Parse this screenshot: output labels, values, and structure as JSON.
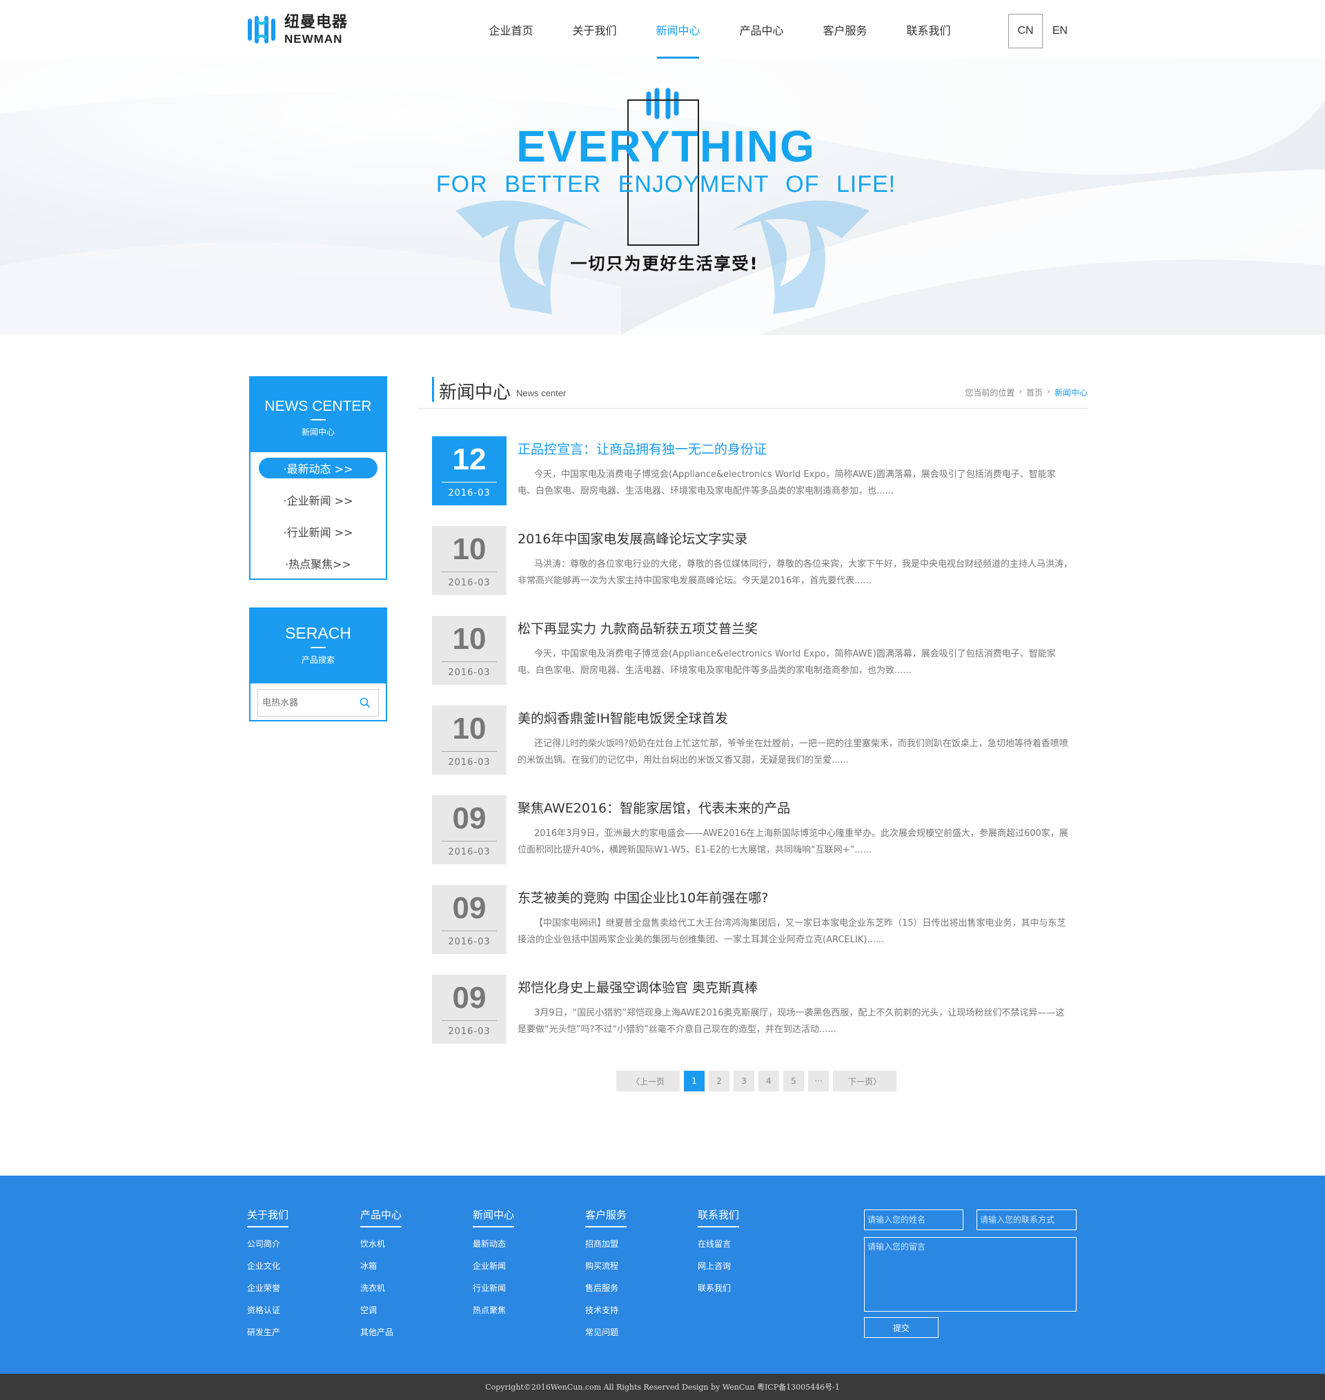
{
  "header": {
    "logo_cn": "纽曼电器",
    "logo_en": "NEWMAN",
    "nav": [
      {
        "label": "企业首页",
        "active": false
      },
      {
        "label": "关于我们",
        "active": false
      },
      {
        "label": "新闻中心",
        "active": true
      },
      {
        "label": "产品中心",
        "active": false
      },
      {
        "label": "客户服务",
        "active": false
      },
      {
        "label": "联系我们",
        "active": false
      }
    ],
    "lang_cn": "CN",
    "lang_en": "EN"
  },
  "banner": {
    "title": "EVERYTHING",
    "subtitle": "FOR BETTER ENJOYMENT OF LIFE!",
    "slogan": "一切只为更好生活享受!"
  },
  "sidebar": {
    "news": {
      "title_en": "NEWS CENTER",
      "title_cn": "新闻中心",
      "items": [
        "·最新动态 >>",
        "·企业新闻 >>",
        "·行业新闻 >>",
        "·热点聚焦>>"
      ],
      "active_index": 0
    },
    "search": {
      "title_en": "SERACH",
      "title_cn": "产品搜索",
      "placeholder": "电热水器"
    }
  },
  "main": {
    "title": "新闻中心",
    "title_en": "News center",
    "breadcrumb": {
      "prefix": "您当前的位置",
      "home": "首页",
      "current": "新闻中心"
    },
    "news": [
      {
        "day": "12",
        "ym": "2016-03",
        "title": "正品控宣言：让商品拥有独一无二的身份证",
        "desc": "今天，中国家电及消费电子博览会(Appliance&electronics World Expo，简称AWE)圆满落幕，展会吸引了包括消费电子、智能家电、白色家电、厨房电器、生活电器、环境家电及家电配件等多品类的家电制造商参加，也......",
        "active": true
      },
      {
        "day": "10",
        "ym": "2016-03",
        "title": "2016年中国家电发展高峰论坛文字实录",
        "desc": "马洪涛：尊敬的各位家电行业的大佬，尊敬的各位媒体同行，尊敬的各位来宾，大家下午好，我是中央电视台财经频道的主持人马洪涛，非常高兴能够再一次为大家主持中国家电发展高峰论坛。今天是2016年，首先要代表......",
        "active": false
      },
      {
        "day": "10",
        "ym": "2016-03",
        "title": "松下再显实力 九款商品斩获五项艾普兰奖",
        "desc": "今天，中国家电及消费电子博览会(Appliance&electronics World Expo，简称AWE)圆满落幕，展会吸引了包括消费电子、智能家电、白色家电、厨房电器、生活电器、环境家电及家电配件等多品类的家电制造商参加，也为致......",
        "active": false
      },
      {
        "day": "10",
        "ym": "2016-03",
        "title": "美的焖香鼎釜IH智能电饭煲全球首发",
        "desc": "还记得儿时的柴火饭吗?奶奶在灶台上忙这忙那，爷爷坐在灶膛前，一把一把的往里塞柴禾，而我们则趴在饭桌上，急切地等待着香喷喷的米饭出锅。在我们的记忆中，用灶台焖出的米饭又香又甜，无疑是我们的至爱......",
        "active": false
      },
      {
        "day": "09",
        "ym": "2016-03",
        "title": "聚焦AWE2016：智能家居馆，代表未来的产品",
        "desc": "2016年3月9日，亚洲最大的家电盛会——AWE2016在上海新国际博览中心隆重举办。此次展会规模空前盛大，参展商超过600家，展位面积同比提升40%，横跨新国际W1-W5、E1-E2的七大展馆，共同嗨响“互联网+”......",
        "active": false
      },
      {
        "day": "09",
        "ym": "2016-03",
        "title": "东芝被美的竞购 中国企业比10年前强在哪?",
        "desc": "【中国家电网讯】继夏普全盘售卖给代工大王台湾鸿海集团后，又一家日本家电企业东芝昨（15）日传出将出售家电业务，其中与东芝接洽的企业包括中国两家企业美的集团与创维集团、一家土耳其企业阿奇立克(ARCELIK)......",
        "active": false
      },
      {
        "day": "09",
        "ym": "2016-03",
        "title": "郑恺化身史上最强空调体验官 奥克斯真棒",
        "desc": "3月9日，“国民小猎豹”郑恺现身上海AWE2016奥克斯展厅，现场一袭黑色西服，配上不久前剃的光头，让现场粉丝们不禁诧异——这是要做“光头恺”吗?不过“小猎豹”丝毫不介意自己现在的造型，并在到达活动......",
        "active": false
      }
    ],
    "pager": {
      "prev": "〈上一页",
      "pages": [
        "1",
        "2",
        "3",
        "4",
        "5",
        "···"
      ],
      "next": "下一页〉",
      "current": "1"
    }
  },
  "footer": {
    "columns": [
      {
        "title": "关于我们",
        "links": [
          "公司简介",
          "企业文化",
          "企业荣誉",
          "资格认证",
          "研发生产"
        ]
      },
      {
        "title": "产品中心",
        "links": [
          "饮水机",
          "冰箱",
          "洗衣机",
          "空调",
          "其他产品"
        ]
      },
      {
        "title": "新闻中心",
        "links": [
          "最新动态",
          "企业新闻",
          "行业新闻",
          "热点聚焦"
        ]
      },
      {
        "title": "客户服务",
        "links": [
          "招商加盟",
          "购买流程",
          "售后服务",
          "技术支持",
          "常见问题"
        ]
      },
      {
        "title": "联系我们",
        "links": [
          "在线留言",
          "网上咨询",
          "联系我们"
        ]
      }
    ],
    "form": {
      "name_placeholder": "请输入您的姓名",
      "contact_placeholder": "请输入您的联系方式",
      "message_placeholder": "请输入您的留言",
      "submit": "提交"
    },
    "copyright": "Copyright©2016WenCun.com All Rights Reserved Design by WenCun 粤ICP备13005446号-1"
  },
  "colors": {
    "accent": "#1a9bf0",
    "footer": "#2a87e2",
    "copyright_bg": "#3a3a3a"
  }
}
